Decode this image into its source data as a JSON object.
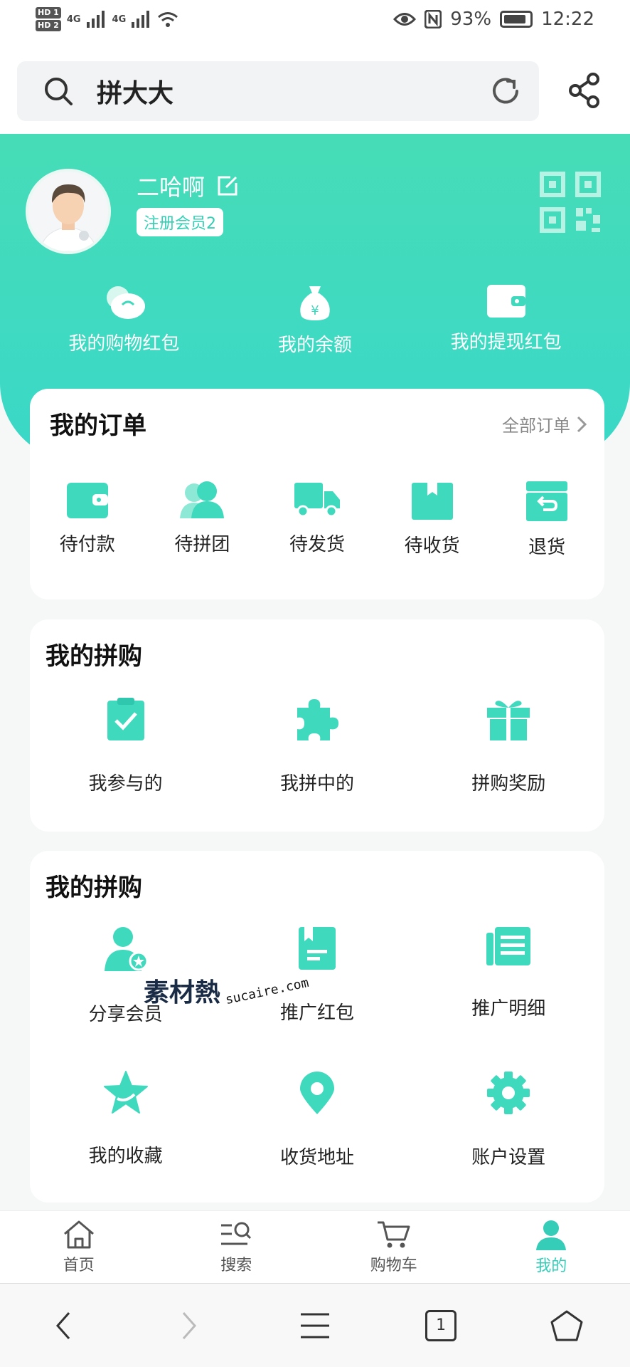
{
  "status_bar": {
    "sim1": "HD 1",
    "sim2": "HD 2",
    "net1": "4G",
    "net2": "4G",
    "battery": "93%",
    "time": "12:22"
  },
  "search": {
    "query": "拼大大"
  },
  "profile": {
    "name": "二哈啊",
    "badge": "注册会员2"
  },
  "wallets": [
    {
      "label": "我的购物红包",
      "icon": "red-packet-icon"
    },
    {
      "label": "我的余额",
      "icon": "money-bag-icon"
    },
    {
      "label": "我的提现红包",
      "icon": "wallet-icon"
    }
  ],
  "orders": {
    "title": "我的订单",
    "all_label": "全部订单",
    "items": [
      {
        "label": "待付款",
        "icon": "wallet-icon"
      },
      {
        "label": "待拼团",
        "icon": "group-icon"
      },
      {
        "label": "待发货",
        "icon": "truck-icon"
      },
      {
        "label": "待收货",
        "icon": "box-icon"
      },
      {
        "label": "退货",
        "icon": "return-box-icon"
      }
    ]
  },
  "pin": {
    "title": "我的拼购",
    "items": [
      {
        "label": "我参与的",
        "icon": "clipboard-check-icon"
      },
      {
        "label": "我拼中的",
        "icon": "puzzle-icon"
      },
      {
        "label": "拼购奖励",
        "icon": "gift-icon"
      }
    ]
  },
  "promo": {
    "title": "我的拼购",
    "items": [
      {
        "label": "分享会员",
        "icon": "member-icon"
      },
      {
        "label": "推广红包",
        "icon": "promo-packet-icon"
      },
      {
        "label": "推广明细",
        "icon": "news-icon"
      },
      {
        "label": "我的收藏",
        "icon": "star-icon"
      },
      {
        "label": "收货地址",
        "icon": "location-icon"
      },
      {
        "label": "账户设置",
        "icon": "gear-icon"
      }
    ]
  },
  "watermark": {
    "brand": "素材熱",
    "site": "sucaire.com"
  },
  "tabs": [
    {
      "label": "首页",
      "icon": "home-icon"
    },
    {
      "label": "搜索",
      "icon": "search-list-icon"
    },
    {
      "label": "购物车",
      "icon": "cart-icon"
    },
    {
      "label": "我的",
      "icon": "user-icon",
      "active": true
    }
  ],
  "sysnav": {
    "tab_count": "1"
  },
  "colors": {
    "accent": "#3fd9bd",
    "text": "#222222",
    "muted": "#888888"
  }
}
